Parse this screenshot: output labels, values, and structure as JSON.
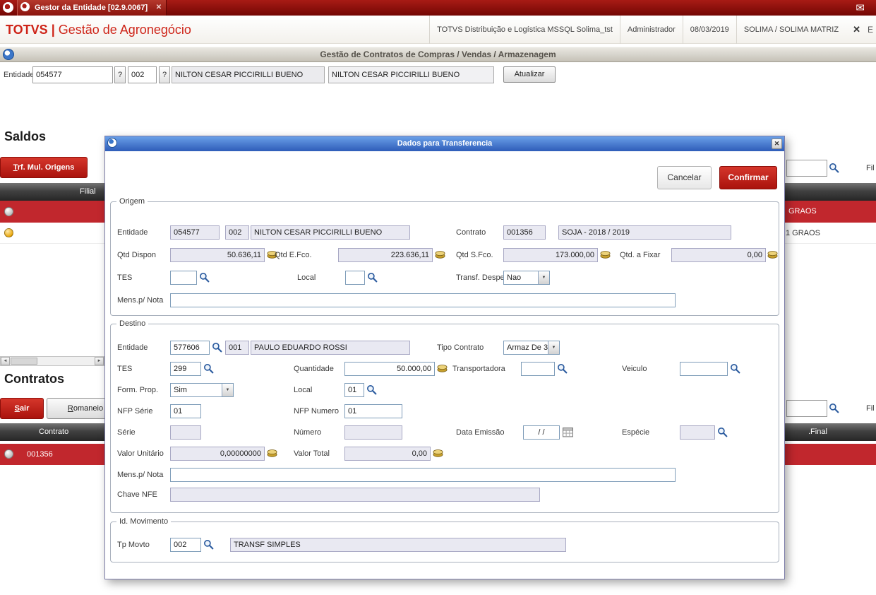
{
  "icons": {
    "mail": "✉",
    "close": "✕",
    "help": "?",
    "dropdown_arrow": "▼",
    "scroll_left": "◄",
    "scroll_right": "►"
  },
  "topbar": {
    "tab_label": "Gestor da Entidade [02.9.0067]"
  },
  "header": {
    "brand_name": "TOTVS",
    "brand_sep": " | ",
    "brand_app": "Gestão de Agronegócio",
    "env": "TOTVS Distribuição e Logística MSSQL Solima_tst",
    "user": "Administrador",
    "date": "08/03/2019",
    "branch": "SOLIMA / SOLIMA MATRIZ",
    "edge": "E"
  },
  "titlebar": {
    "title": "Gestão de Contratos de Compras / Vendas / Armazenagem"
  },
  "entity_form": {
    "label": "Entidade",
    "code": "054577",
    "store": "002",
    "name": "NILTON CESAR PICCIRILLI BUENO",
    "name2": "NILTON CESAR PICCIRILLI BUENO",
    "refresh": "Atualizar"
  },
  "saldos": {
    "heading": "Saldos",
    "trf_button": "Trf. Mul. Origens",
    "filter_label": "Fil",
    "col_filial": "Filial",
    "row1_text": "GRAOS",
    "row2_text": "1 GRAOS"
  },
  "contratos": {
    "heading": "Contratos",
    "sair_button": "Sair",
    "romaneio_button": "Romaneio",
    "filter_label": "Fil",
    "col_contrato": "Contrato",
    "col_final": ".Final",
    "row_code": "001356"
  },
  "modal": {
    "title": "Dados para Transferencia",
    "cancel": "Cancelar",
    "confirm": "Confirmar",
    "origem": {
      "legend": "Origem",
      "lbl_entidade": "Entidade",
      "entidade": "054577",
      "loja": "002",
      "nome": "NILTON CESAR PICCIRILLI BUENO",
      "lbl_contrato": "Contrato",
      "contrato": "001356",
      "contrato_desc": "SOJA  - 2018 / 2019",
      "lbl_qtd_dispon": "Qtd Dispon",
      "qtd_dispon": "50.636,11",
      "lbl_qtd_efco": "Qtd E.Fco.",
      "qtd_efco": "223.636,11",
      "lbl_qtd_sfco": "Qtd S.Fco.",
      "qtd_sfco": "173.000,00",
      "lbl_qtd_fixar": "Qtd. a Fixar",
      "qtd_fixar": "0,00",
      "lbl_tes": "TES",
      "tes": "",
      "lbl_local": "Local",
      "local": "",
      "lbl_transf_despesa": "Transf. Despesa",
      "transf_despesa": "Nao",
      "lbl_mens": "Mens.p/ Nota",
      "mens": ""
    },
    "destino": {
      "legend": "Destino",
      "lbl_entidade": "Entidade",
      "entidade": "577606",
      "loja": "001",
      "nome": "PAULO EDUARDO ROSSI",
      "lbl_tipo_contrato": "Tipo Contrato",
      "tipo_contrato": "Armaz De 3",
      "lbl_tes": "TES",
      "tes": "299",
      "lbl_quantidade": "Quantidade",
      "quantidade": "50.000,00",
      "lbl_transportadora": "Transportadora",
      "transportadora": "",
      "lbl_veiculo": "Veiculo",
      "veiculo": "",
      "lbl_form_prop": "Form. Prop.",
      "form_prop": "Sim",
      "lbl_local": "Local",
      "local": "01",
      "lbl_nfp_serie": "NFP Série",
      "nfp_serie": "01",
      "lbl_nfp_numero": "NFP Numero",
      "nfp_numero": "01",
      "lbl_serie": "Série",
      "serie": "",
      "lbl_numero": "Número",
      "numero": "",
      "lbl_data_emissao": "Data Emissão",
      "data_emissao": "/  /",
      "lbl_especie": "Espécie",
      "especie": "",
      "lbl_valor_unitario": "Valor Unitário",
      "valor_unitario": "0,00000000",
      "lbl_valor_total": "Valor Total",
      "valor_total": "0,00",
      "lbl_mens": "Mens.p/ Nota",
      "mens": "",
      "lbl_chave_nfe": "Chave NFE",
      "chave_nfe": ""
    },
    "movimento": {
      "legend": "Id. Movimento",
      "lbl_tp_movto": "Tp Movto",
      "tp_movto": "002",
      "tp_movto_desc": "TRANSF SIMPLES"
    }
  }
}
